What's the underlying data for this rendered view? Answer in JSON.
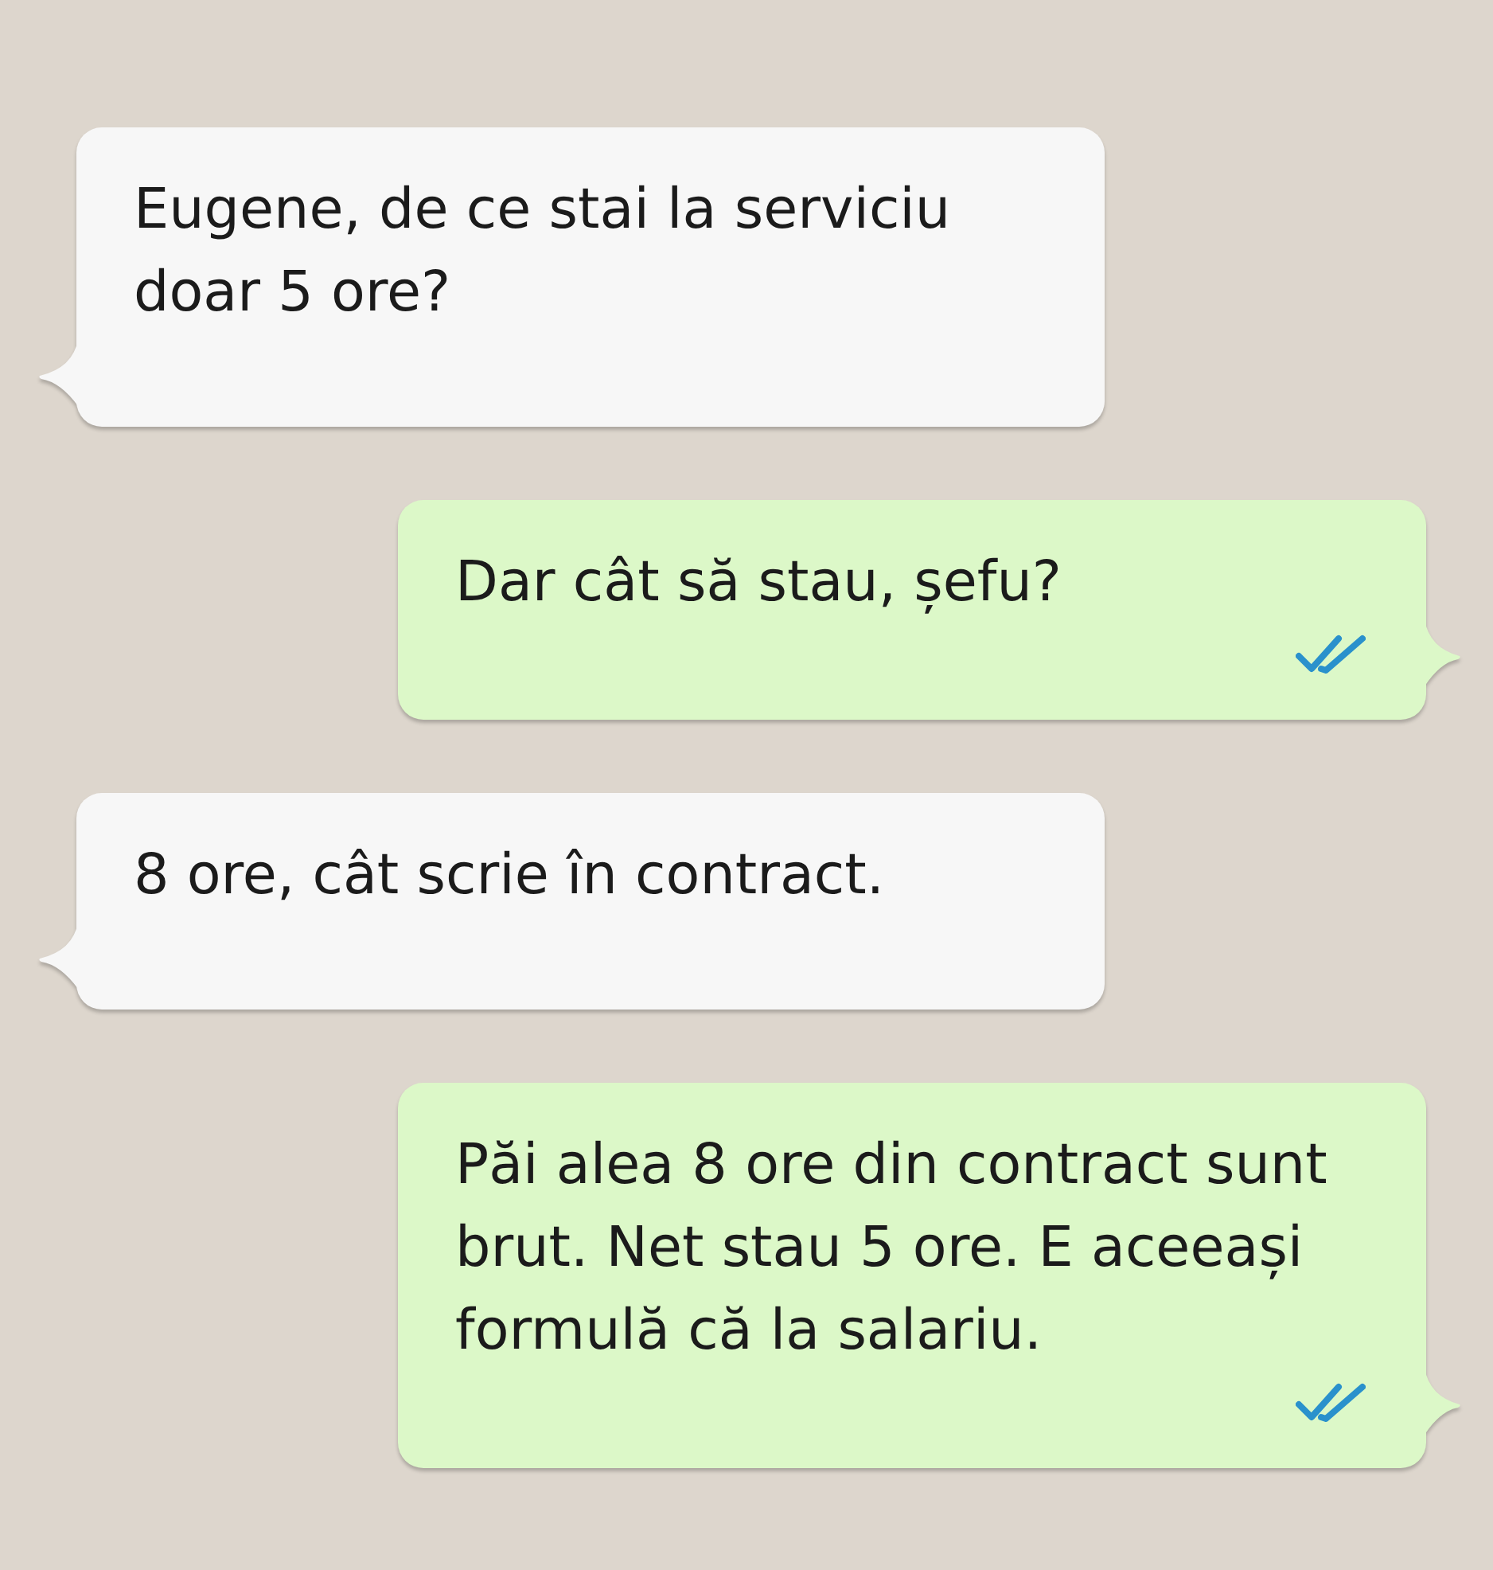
{
  "messages": [
    {
      "kind": "incoming",
      "text": "Eugene, de ce stai la serviciu doar 5 ore?"
    },
    {
      "kind": "outgoing",
      "text": "Dar cât să stau, șefu?",
      "read": true
    },
    {
      "kind": "incoming",
      "text": "8 ore, cât scrie în contract."
    },
    {
      "kind": "outgoing",
      "text": "Păi alea 8 ore din contract sunt brut. Net stau 5 ore. E aceeași formulă că la salariu.",
      "read": true
    }
  ]
}
